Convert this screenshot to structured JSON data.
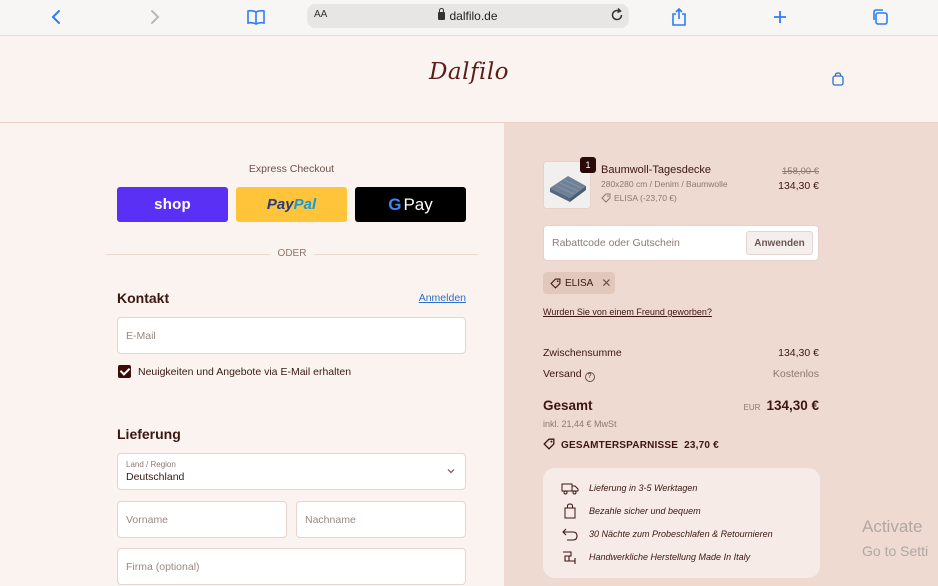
{
  "browser": {
    "text_size_label": "AA",
    "url": "dalfilo.de"
  },
  "header": {
    "logo_text": "Dalfilo"
  },
  "checkout": {
    "express_label": "Express Checkout",
    "shop_label": "shop",
    "paypal_part1": "Pay",
    "paypal_part2": "Pal",
    "gpay_g": "G",
    "gpay_label": "Pay",
    "divider_text": "ODER",
    "contact": {
      "title": "Kontakt",
      "login_link": "Anmelden",
      "email_placeholder": "E-Mail",
      "newsletter_label": "Neuigkeiten und Angebote via E-Mail erhalten",
      "newsletter_checked": true
    },
    "delivery": {
      "title": "Lieferung",
      "country_label": "Land / Region",
      "country_value": "Deutschland",
      "firstname_placeholder": "Vorname",
      "lastname_placeholder": "Nachname",
      "company_placeholder": "Firma (optional)"
    }
  },
  "summary": {
    "product": {
      "quantity": "1",
      "name": "Baumwoll-Tagesdecke",
      "variant": "280x280 cm / Denim / Baumwolle",
      "discount_line": "ELISA (-23,70 €)",
      "old_price": "158,00 €",
      "new_price": "134,30 €"
    },
    "discount_placeholder": "Rabattcode oder Gutschein",
    "apply_label": "Anwenden",
    "applied_code": "ELISA",
    "referral_link": "Wurden Sie von einem Freund geworben?",
    "subtotal_label": "Zwischensumme",
    "subtotal_value": "134,30 €",
    "shipping_label": "Versand",
    "shipping_value": "Kostenlos",
    "total_label": "Gesamt",
    "total_currency": "EUR",
    "total_value": "134,30 €",
    "vat_text": "inkl. 21,44 € MwSt",
    "savings_text": "GESAMTERSPARNISSE  23,70 €",
    "benefits": [
      {
        "icon": "truck-icon",
        "text": "Lieferung in 3-5 Werktagen"
      },
      {
        "icon": "bag-icon",
        "text": "Bezahle sicher und bequem"
      },
      {
        "icon": "return-icon",
        "text": "30 Nächte zum Probeschlafen & Retournieren"
      },
      {
        "icon": "sewing-icon",
        "text": "Handwerkliche Herstellung Made In Italy"
      }
    ]
  },
  "os_watermark": {
    "line1": "Activate",
    "line2": "Go to Setti"
  },
  "colors": {
    "shop_pay": "#5a31f4",
    "paypal": "#ffc439",
    "gpay": "#000000",
    "accent_dark": "#3e0a08",
    "left_bg": "#faf3ef",
    "right_bg": "#eedad0"
  }
}
